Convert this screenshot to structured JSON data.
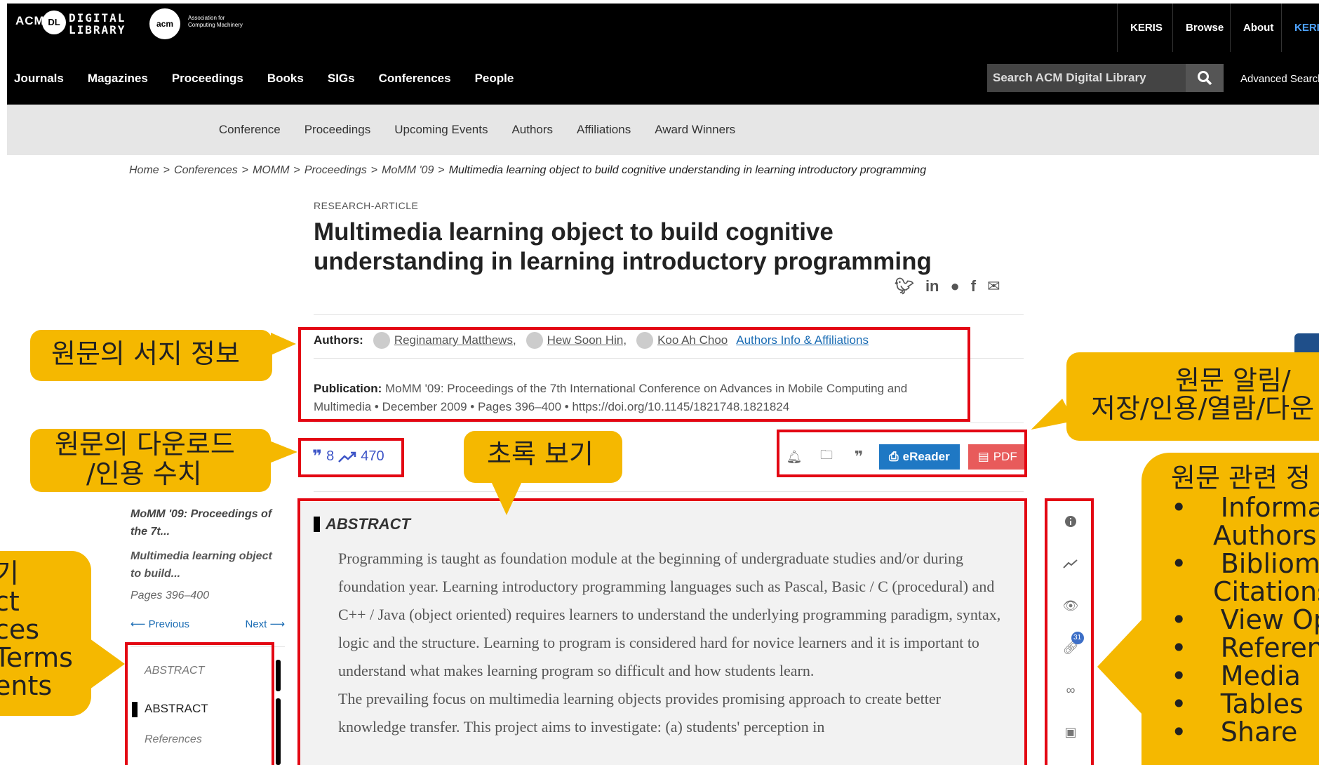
{
  "header": {
    "logo_acm": "ACM",
    "logo_dl": "DL",
    "logo_digital_library": [
      "DIGITAL",
      "LIBRARY"
    ],
    "acm_circle": "acm",
    "acm_org": [
      "Association for",
      "Computing Machinery"
    ],
    "top_links": [
      "KERIS",
      "Browse",
      "About",
      "KERIS"
    ],
    "main_nav": [
      "Journals",
      "Magazines",
      "Proceedings",
      "Books",
      "SIGs",
      "Conferences",
      "People"
    ],
    "search_placeholder": "Search ACM Digital Library",
    "advanced_search": "Advanced Search"
  },
  "subnav": [
    "Conference",
    "Proceedings",
    "Upcoming Events",
    "Authors",
    "Affiliations",
    "Award Winners"
  ],
  "breadcrumb": [
    "Home",
    "Conferences",
    "MOMM",
    "Proceedings",
    "MoMM '09",
    "Multimedia learning object to build cognitive understanding in learning introductory programming"
  ],
  "article": {
    "type": "RESEARCH-ARTICLE",
    "title": "Multimedia learning object to build cognitive understanding in learning introductory programming",
    "share_icons": [
      "twitter-icon",
      "linkedin-icon",
      "reddit-icon",
      "facebook-icon",
      "email-icon"
    ],
    "authors_label": "Authors:",
    "authors": [
      "Reginamary Matthews,",
      "Hew Soon Hin,",
      "Koo Ah Choo"
    ],
    "authors_info": "Authors Info & Affiliations",
    "publication_label": "Publication:",
    "publication_text": "MoMM '09: Proceedings of the 7th International Conference on Advances in Mobile Computing and Multimedia • December 2009 • Pages 396–400 • https://doi.org/10.1145/1821748.1821824",
    "citations": "8",
    "downloads": "470",
    "toolbar_icons": [
      "bell-icon",
      "folder-add-icon",
      "quote-icon"
    ],
    "ereader_label": "eReader",
    "pdf_label": "PDF"
  },
  "leftcard": {
    "proc": "MoMM '09: Proceedings of the 7t...",
    "article": "Multimedia learning object to build...",
    "pages": "Pages 396–400",
    "prev": "⟵ Previous",
    "next": "Next ⟶",
    "toc_header": "ABSTRACT",
    "toc_active": "ABSTRACT",
    "toc_refs": "References"
  },
  "abstract": {
    "header": "ABSTRACT",
    "p1": "Programming is taught as foundation module at the beginning of undergraduate studies and/or during foundation year. Learning introductory programming languages such as Pascal, Basic / C (procedural) and C++ / Java (object oriented) requires learners to understand the underlying programming paradigm, syntax, logic and the structure. Learning to program is considered hard for novice learners and it is important to understand what makes learning program so difficult and how students learn.",
    "p2": "The prevailing focus on multimedia learning objects provides promising approach to create better knowledge transfer. This project aims to investigate: (a) students' perception in"
  },
  "rail": {
    "icons": [
      "info-icon",
      "trend-icon",
      "eye-icon",
      "reference-icon",
      "link-icon",
      "image-icon"
    ],
    "ref_badge": "31"
  },
  "callouts": {
    "bib": "원문의 서지 정보",
    "dl_line1": "원문의 다운로드",
    "dl_line2": "/인용 수치",
    "abs": "초록 보기",
    "alert_line1": "원문 알림/",
    "alert_line2": "저장/인용/열람/다운",
    "related_title": "원문 관련 정",
    "related_items": [
      "Informati",
      "Authors",
      "Bibliomet",
      "Citations",
      "View Opt",
      "Reference",
      "Media",
      "Tables",
      "Share"
    ],
    "left_lines": [
      "기",
      "ct",
      "ces",
      "Terms",
      "ents"
    ]
  },
  "colors": {
    "accent_red": "#e30613",
    "callout": "#f5b800",
    "link_blue": "#1a6cb4",
    "ereader": "#1f78c4",
    "pdf": "#e85b5b"
  }
}
